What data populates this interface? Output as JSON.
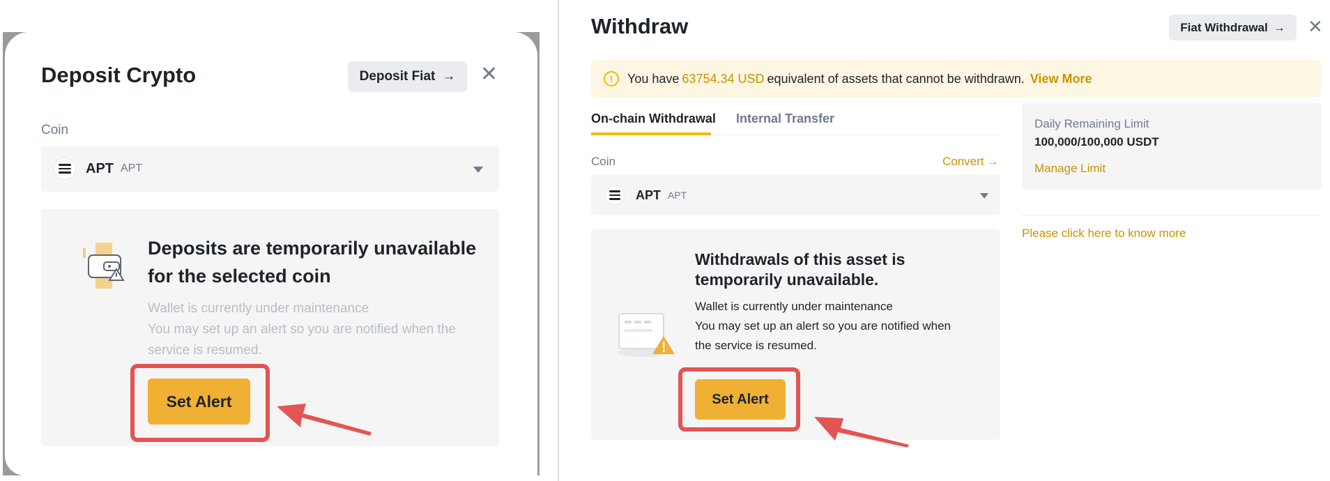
{
  "deposit": {
    "title": "Deposit Crypto",
    "fiat_button": "Deposit Fiat",
    "coin_label": "Coin",
    "coin": {
      "name": "APT",
      "ticker": "APT"
    },
    "notice_heading_line1": "Deposits are temporarily unavailable",
    "notice_heading_line2": "for the selected coin",
    "notice_body_line1": "Wallet is currently under maintenance",
    "notice_body_line2": "You may set up an alert so you are notified when the",
    "notice_body_line3": "service is resumed.",
    "alert_button": "Set Alert"
  },
  "withdraw": {
    "title": "Withdraw",
    "fiat_button": "Fiat Withdrawal",
    "banner": {
      "prefix": "You have",
      "amount": "63754.34 USD",
      "suffix": "equivalent of assets that cannot be withdrawn.",
      "link": "View More"
    },
    "tabs": [
      {
        "label": "On-chain Withdrawal",
        "active": true
      },
      {
        "label": "Internal Transfer",
        "active": false
      }
    ],
    "coin_label": "Coin",
    "convert_link": "Convert",
    "coin": {
      "name": "APT",
      "ticker": "APT"
    },
    "notice_heading_line1": "Withdrawals of this asset is",
    "notice_heading_line2": "temporarily unavailable.",
    "notice_body_line1": "Wallet is currently under maintenance",
    "notice_body_line2": "You may set up an alert so you are notified when",
    "notice_body_line3": "the service is resumed.",
    "alert_button": "Set Alert",
    "limit": {
      "label": "Daily Remaining Limit",
      "value": "100,000/100,000 USDT",
      "link": "Manage Limit"
    },
    "know_more": "Please click here to know more"
  },
  "icons": [
    "close-icon",
    "arrow-right-icon",
    "caret-down-icon",
    "info-icon",
    "wallet-warning-icon",
    "apt-coin-icon"
  ],
  "colors": {
    "accent": "#F0B90B",
    "button": "#F0B033",
    "link": "#C99400",
    "highlight": "#E35454",
    "panel": "#F5F5F5"
  }
}
